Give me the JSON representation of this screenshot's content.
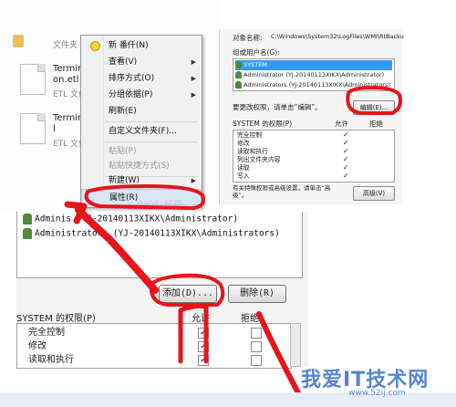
{
  "explorer": {
    "folder_type": "文件夹",
    "files": [
      {
        "name": "Terminal",
        "name2": "on.etl",
        "type": "ETL 文件"
      },
      {
        "name": "Terminal",
        "name2": "l",
        "type": "ETL 文件"
      }
    ]
  },
  "context_menu": {
    "items": [
      {
        "label": "新 番仟(N)"
      },
      {
        "label": "查看(V)",
        "arrow": "▶"
      },
      {
        "label": "排序方式(O)",
        "arrow": "▶"
      },
      {
        "label": "分组依据(P)",
        "arrow": "▶"
      },
      {
        "label": "刷新(E)"
      },
      {
        "label": "自定义文件夹(F)..."
      },
      {
        "label": "粘贴(P)"
      },
      {
        "label": "粘贴快捷方式(S)"
      },
      {
        "label": "新建(W)",
        "arrow": "▶"
      },
      {
        "label": "属性(R)"
      }
    ],
    "watermark": "Baidu经验"
  },
  "security_top": {
    "object_label": "对象名称:",
    "object_path": "C:\\Windows\\System32\\LogFiles\\WMI\\RtBacku",
    "group_label": "组或用户名(G):",
    "users": [
      "SYSTEM",
      "Administrator  (YJ-20140113XIKX\\Administrator)",
      "Administrators  (YJ-20140113XIKX\\Administrators)"
    ],
    "change_hint": "要更改权限，请单击“编辑”。",
    "edit_button": "编辑(E)...",
    "perm_title": "SYSTEM 的权限(P)",
    "allow_col": "允许",
    "deny_col": "拒绝",
    "perms": [
      "完全控制",
      "修改",
      "读取和执行",
      "列出文件夹内容",
      "读取",
      "写入"
    ],
    "check": "✓",
    "adv_hint": "有关特殊权限或高级设置，请单击“高级”。",
    "advanced_button": "高级(V)"
  },
  "bottom_dialog": {
    "users": [
      "Adminis        (YJ-20140113XIKX\\Administrator)",
      "Administrators (YJ-20140113XIKX\\Administrators)"
    ],
    "add_button": "添加(D)...",
    "remove_button": "删除(R)",
    "perm_title": "SYSTEM 的权限(P)",
    "allow_col": "允许",
    "deny_col": "拒绝",
    "perms": [
      {
        "label": "完全控制",
        "allow": true,
        "deny": false
      },
      {
        "label": "修改",
        "allow": true,
        "deny": false
      },
      {
        "label": "读取和执行",
        "allow": true,
        "deny": false
      }
    ]
  },
  "watermark": {
    "text": "我爱IT技术网",
    "url": "www.52ij.com"
  },
  "colors": {
    "annotation_red": "#e8141b",
    "selection_blue": "#3399ff"
  }
}
